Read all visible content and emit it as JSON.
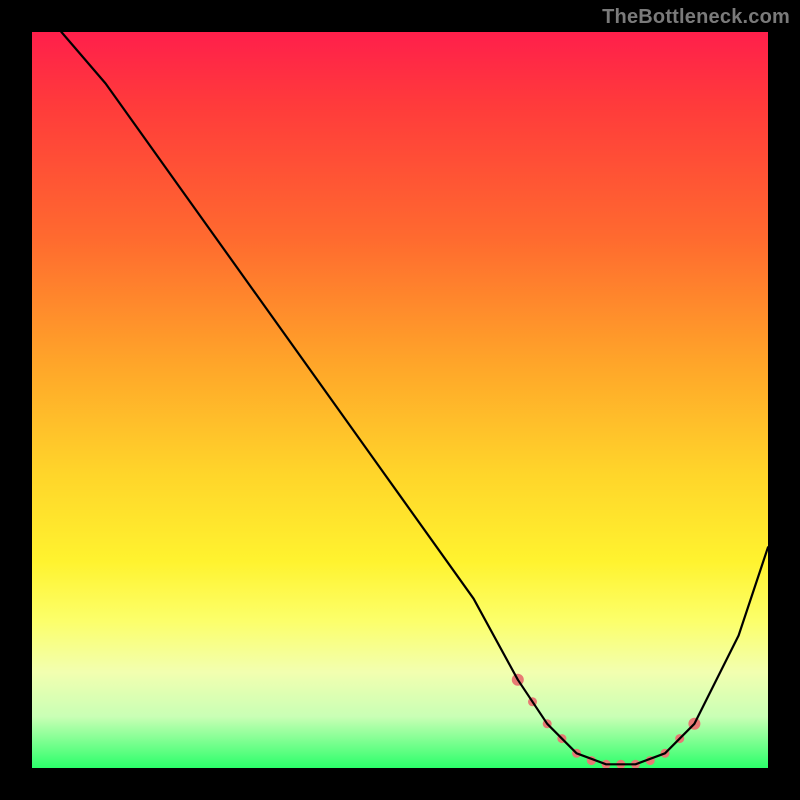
{
  "watermark": "TheBottleneck.com",
  "chart_data": {
    "type": "line",
    "title": "",
    "xlabel": "",
    "ylabel": "",
    "xlim": [
      0,
      100
    ],
    "ylim": [
      0,
      100
    ],
    "series": [
      {
        "name": "bottleneck-curve",
        "x": [
          4,
          10,
          20,
          30,
          40,
          50,
          60,
          66,
          70,
          74,
          78,
          82,
          86,
          90,
          96,
          100
        ],
        "y": [
          100,
          93,
          79,
          65,
          51,
          37,
          23,
          12,
          6,
          2,
          0.5,
          0.5,
          2,
          6,
          18,
          30
        ]
      }
    ],
    "marker_points": {
      "name": "optimal-range-dots",
      "color": "#e77a74",
      "x": [
        66,
        68,
        70,
        72,
        74,
        76,
        78,
        80,
        82,
        84,
        86,
        88,
        90
      ],
      "y": [
        12,
        9,
        6,
        4,
        2,
        1,
        0.5,
        0.5,
        0.5,
        1,
        2,
        4,
        6
      ]
    }
  }
}
